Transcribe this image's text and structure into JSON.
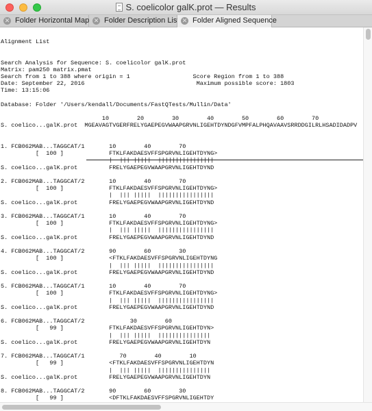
{
  "window": {
    "title": "S. coelicolor galK.prot — Results"
  },
  "tabs": [
    {
      "label": "Folder Horizontal Map"
    },
    {
      "label": "Folder Description List"
    },
    {
      "label": "Folder Aligned Sequence"
    }
  ],
  "report": {
    "heading": "Alignment List",
    "search_line": "Search Analysis for Sequence: S. coelicolor galK.prot",
    "matrix_line": "Matrix: pam250 matrix.pmat",
    "search_range_line": "Search from 1 to 388 where origin = 1                  Score Region from 1 to 388",
    "date_line": "Date: September 22, 2016                                Maximum possible score: 1803",
    "time_line": "Time: 13:15:06",
    "database_line": "Database: Folder '/Users/kendall/Documents/FastQTests/Mullin/Data'",
    "query_ruler": "                             10        20        30        40        50        60        70",
    "query_line": "S. coelico...galK.prot  MGEAVAGTVGERFRELYGAEPEGVWAAPGRVNLIGEHTDYNDGFVMPFALPHQAVAAVSRRDDGILRLHSADIDADPV",
    "alignments": [
      {
        "hit": "1. FCB062MAB...TAGGCAT/1",
        "ruler": "                10        40        70",
        "score": "          [  100 ]",
        "hit_seq": "FTKLFAKDAESVFFSPGRVNLIGEHTDYNG>",
        "match": "|  ||| |||||  ||||||||||||||||",
        "query": "S. coelico...galK.prot",
        "query_seq": "FRELYGAEPEGVWAAPGRVNLIGEHTDYND"
      },
      {
        "hit": "2. FCB062MAB...TAGGCAT/2",
        "ruler": "                10        40        70",
        "score": "          [  100 ]",
        "hit_seq": "FTKLFAKDAESVFFSPGRVNLIGEHTDYNG>",
        "match": "|  ||| |||||  ||||||||||||||||",
        "query": "S. coelico...galK.prot",
        "query_seq": "FRELYGAEPEGVWAAPGRVNLIGEHTDYND"
      },
      {
        "hit": "3. FCB062MAB...TAGGCAT/1",
        "ruler": "                10        40        70",
        "score": "          [  100 ]",
        "hit_seq": "FTKLFAKDAESVFFSPGRVNLIGEHTDYNG>",
        "match": "|  ||| |||||  ||||||||||||||||",
        "query": "S. coelico...galK.prot",
        "query_seq": "FRELYGAEPEGVWAAPGRVNLIGEHTDYND"
      },
      {
        "hit": "4. FCB062MAB...TAGGCAT/2",
        "ruler": "             90        60        30",
        "score": "          [  100 ]",
        "hit_seq": "<FTKLFAKDAESVFFSPGRVNLIGEHTDYNG",
        "match": "|  ||| |||||  ||||||||||||||||",
        "query": "S. coelico...galK.prot",
        "query_seq": "FRELYGAEPEGVWAAPGRVNLIGEHTDYND"
      },
      {
        "hit": "5. FCB062MAB...TAGGCAT/1",
        "ruler": "                10        40        70",
        "score": "          [  100 ]",
        "hit_seq": "FTKLFAKDAESVFFSPGRVNLIGEHTDYNG>",
        "match": "|  ||| |||||  ||||||||||||||||",
        "query": "S. coelico...galK.prot",
        "query_seq": "FRELYGAEPEGVWAAPGRVNLIGEHTDYND"
      },
      {
        "hit": "6. FCB062MAB...TAGGCAT/2",
        "ruler": "                      30        60",
        "score": "          [   99 ]",
        "hit_seq": "FTKLFAKDAESVFFSPGRVNLIGEHTDYN>",
        "match": "|  ||| |||||  |||||||||||||||",
        "query": "S. coelico...galK.prot",
        "query_seq": "FRELYGAEPEGVWAAPGRVNLIGEHTDYN"
      },
      {
        "hit": "7. FCB062MAB...TAGGCAT/1",
        "ruler": "                   70        40        10",
        "score": "          [   99 ]",
        "hit_seq": "<FTKLFAKDAESVFFSPGRVNLIGEHTDYN",
        "match": "|  ||| |||||  |||||||||||||||",
        "query": "S. coelico...galK.prot",
        "query_seq": "FRELYGAEPEGVWAAPGRVNLIGEHTDYN"
      },
      {
        "hit": "8. FCB062MAB...TAGGCAT/2",
        "ruler": "            90        60        30",
        "score": "          [   99 ]",
        "hit_seq": "<DFTKLFAKDAESVFFSPGRVNLIGEHTDY",
        "match": "|  ||| |||||  ||||||||||||||",
        "query": "S. coelico...galK.prot",
        "query_seq": "RFRELYGAEPEGVWAAPGRVNLIGEHTDY"
      }
    ]
  }
}
